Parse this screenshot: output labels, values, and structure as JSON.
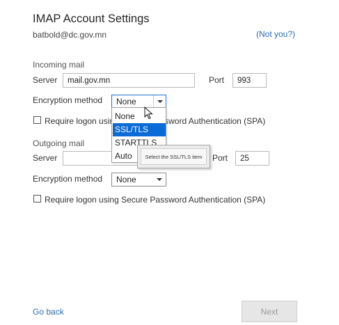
{
  "header": {
    "title": "IMAP Account Settings",
    "account": "batbold@dc.gov.mn",
    "not_you": "(Not you?)"
  },
  "incoming": {
    "section": "Incoming mail",
    "server_label": "Server",
    "server_value": "mail.gov.mn",
    "port_label": "Port",
    "port_value": "993",
    "encryption_label": "Encryption method",
    "encryption_value": "None",
    "spa_label": "Require logon using Secure Password Authentication (SPA)"
  },
  "dropdown": {
    "options": [
      "None",
      "SSL/TLS",
      "STARTTLS",
      "Auto"
    ],
    "selected_index": 1
  },
  "tooltip": {
    "text": "Select the SSL/TLS item"
  },
  "outgoing": {
    "section": "Outgoing mail",
    "server_label": "Server",
    "server_value": "",
    "port_label": "Port",
    "port_value": "25",
    "encryption_label": "Encryption method",
    "encryption_value": "None",
    "spa_label": "Require logon using Secure Password Authentication (SPA)"
  },
  "footer": {
    "go_back": "Go back",
    "next": "Next"
  }
}
